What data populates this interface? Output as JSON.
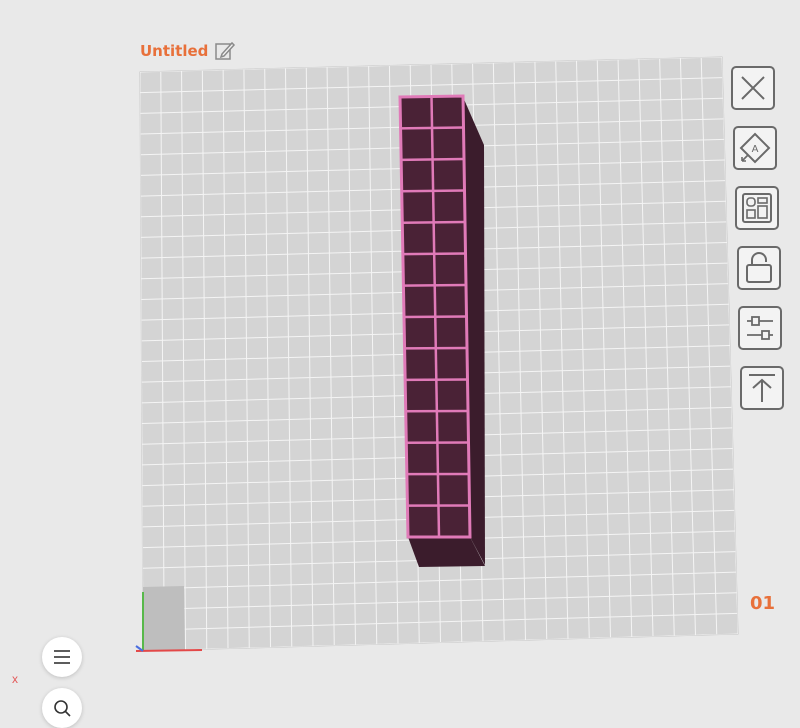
{
  "document": {
    "title": "Untitled"
  },
  "plate": {
    "number": "01"
  },
  "axis": {
    "x_label": "x"
  },
  "icons": {
    "edit": "pencil-square-icon",
    "close": "close-icon",
    "auto_arrange": "auto-arrange-icon",
    "layout": "layout-grid-icon",
    "lock": "unlock-icon",
    "settings": "sliders-icon",
    "export": "export-up-icon",
    "menu": "hamburger-menu-icon",
    "search": "search-icon"
  },
  "colors": {
    "accent": "#e8703a",
    "model_edge": "#e07ab8",
    "model_fill": "#4a2236"
  }
}
